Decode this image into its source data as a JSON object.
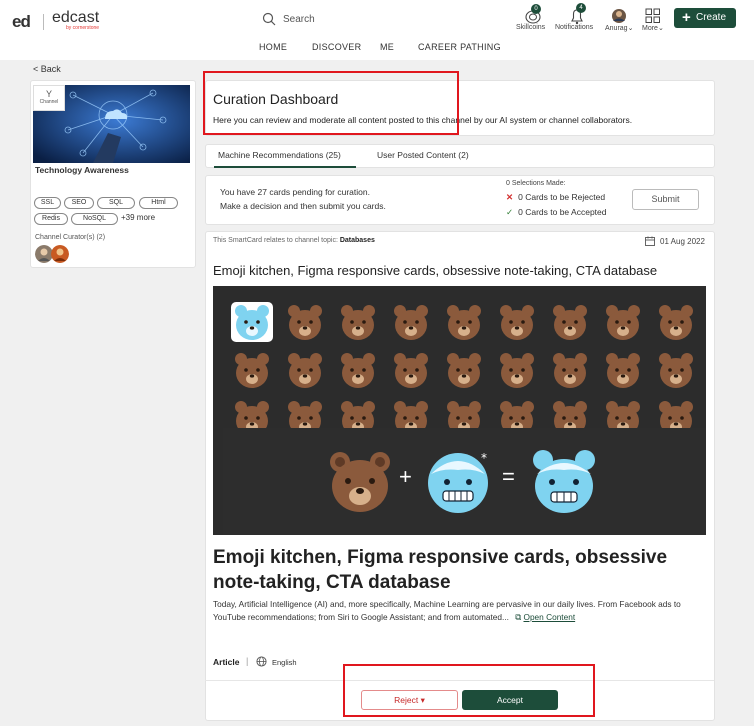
{
  "header": {
    "brand_short": "ed",
    "brand_name": "edcast",
    "brand_sub": "by cornerstone",
    "search_placeholder": "Search",
    "icons": [
      {
        "name": "skillcoins-icon",
        "label": "Skillcoins",
        "badge": "0"
      },
      {
        "name": "bell-icon",
        "label": "Notifications",
        "badge": "4"
      },
      {
        "name": "avatar",
        "label": "Anurag"
      },
      {
        "name": "grid-icon",
        "label": "More"
      }
    ],
    "create_label": "Create",
    "nav": [
      "HOME",
      "DISCOVER",
      "ME",
      "CAREER PATHING"
    ]
  },
  "back_label": "< Back",
  "channel": {
    "badge_label": "Channel",
    "title": "Technology Awareness",
    "tags": [
      "SSL",
      "SEO",
      "SQL",
      "Html",
      "Redis",
      "NoSQL"
    ],
    "more_tags": "+39 more",
    "curators_label": "Channel Curator(s) (2)"
  },
  "dashboard": {
    "title": "Curation Dashboard",
    "subtitle": "Here you can review and moderate all content posted to this channel by our AI system or channel collaborators."
  },
  "tabs": [
    {
      "label": "Machine Recommendations (25)",
      "active": true
    },
    {
      "label": "User Posted Content (2)",
      "active": false
    }
  ],
  "pending": {
    "line1": "You have 27 cards pending for curation.",
    "line2": "Make a decision and then submit you cards.",
    "selections": "0 Selections Made:",
    "rejected": "0 Cards to be Rejected",
    "accepted": "0 Cards to be Accepted",
    "submit_label": "Submit"
  },
  "smartcard": {
    "topic_prefix": "This SmartCard relates to channel topic:",
    "topic": "Databases",
    "date": "01 Aug 2022",
    "title": "Emoji kitchen, Figma responsive cards, obsessive note-taking, CTA database",
    "big_title": "Emoji kitchen, Figma responsive cards, obsessive note-taking, CTA database",
    "description": "Today, Artificial Intelligence (AI) and, more specifically, Machine Learning are pervasive in our daily lives. From Facebook ads to YouTube recommendations; from Siri to Google Assistant; and from automated...",
    "open_content_label": "Open Content",
    "type": "Article",
    "language": "English",
    "combo_plus": "+",
    "combo_equals": "="
  },
  "actions": {
    "reject_label": "Reject ▾",
    "accept_label": "Accept"
  },
  "colors": {
    "brand_green": "#1d4d3a",
    "highlight_red": "#e0171e",
    "reject_red": "#c62828",
    "emoji_bg": "#2c2c2c"
  }
}
